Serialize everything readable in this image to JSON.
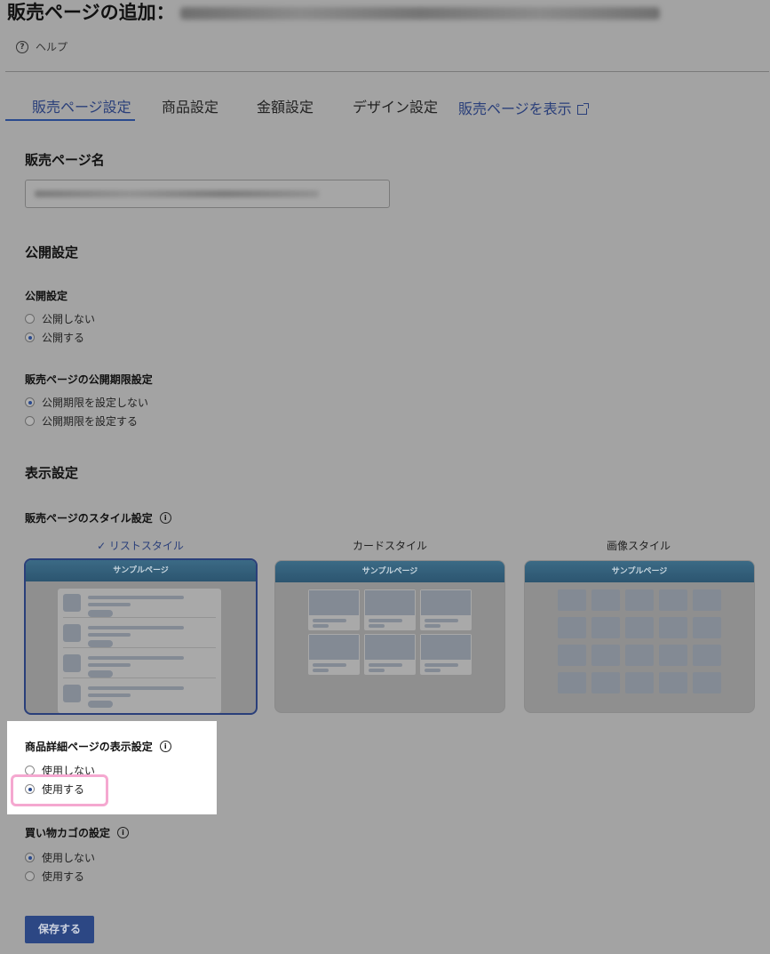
{
  "header": {
    "title": "販売ページの追加：",
    "help_label": "ヘルプ"
  },
  "tabs": [
    {
      "label": "販売ページ設定",
      "active": true
    },
    {
      "label": "商品設定"
    },
    {
      "label": "金額設定"
    },
    {
      "label": "デザイン設定"
    },
    {
      "label": "販売ページを表示"
    }
  ],
  "sections": {
    "page_name": {
      "heading": "販売ページ名"
    },
    "publish": {
      "heading": "公開設定",
      "publish_setting": {
        "label": "公開設定",
        "options": [
          "公開しない",
          "公開する"
        ],
        "selected": 1
      },
      "period_setting": {
        "label": "販売ページの公開期限設定",
        "options": [
          "公開期限を設定しない",
          "公開期限を設定する"
        ],
        "selected": 0
      }
    },
    "display": {
      "heading": "表示設定",
      "style_setting": {
        "label": "販売ページのスタイル設定",
        "styles": [
          {
            "label": "✓ リストスタイル",
            "selected": true
          },
          {
            "label": "カードスタイル"
          },
          {
            "label": "画像スタイル"
          }
        ],
        "sample_label": "サンプルページ"
      },
      "detail_page": {
        "label": "商品詳細ページの表示設定",
        "options": [
          "使用しない",
          "使用する"
        ],
        "selected": 1
      },
      "cart": {
        "label": "買い物カゴの設定",
        "options": [
          "使用しない",
          "使用する"
        ],
        "selected": 0
      }
    }
  },
  "save_button": "保存する",
  "colors": {
    "accent": "#2a4a8e",
    "highlight": "#f5a8d0",
    "overlay": "#a3a3a3"
  }
}
